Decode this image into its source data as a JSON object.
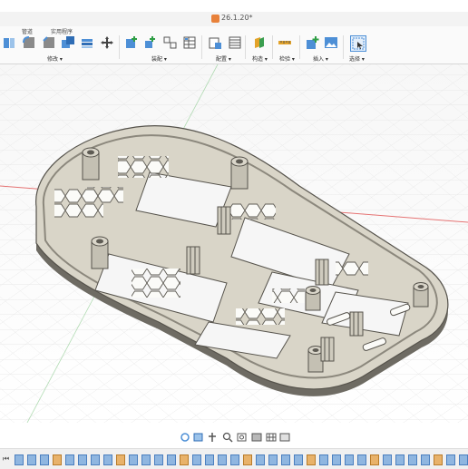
{
  "title": {
    "doc_name": "26.1.20*"
  },
  "toolbar": {
    "tabs": [
      "管道",
      "实用程序"
    ],
    "groups": [
      {
        "label": "修改 ▾"
      },
      {
        "label": "装配 ▾"
      },
      {
        "label": "配置 ▾"
      },
      {
        "label": "构造 ▾"
      },
      {
        "label": "检验 ▾"
      },
      {
        "label": "插入 ▾"
      },
      {
        "label": "选择 ▾"
      }
    ]
  },
  "colors": {
    "part_fill": "#d9d5c8",
    "part_edge": "#6d6a61",
    "grid": "#e4e4e4",
    "axis_red": "#e57373"
  },
  "icons": [
    "shell-icon",
    "fillet-icon",
    "chamfer-icon",
    "combine-icon",
    "move-icon",
    "joint-icon",
    "new-component-icon",
    "rigid-group-icon",
    "config-table-icon",
    "plane-icon",
    "measure-icon",
    "insert-icon",
    "image-icon",
    "select-icon",
    "orbit-icon",
    "pan-icon",
    "zoom-icon",
    "display-icon",
    "grid-icon"
  ]
}
